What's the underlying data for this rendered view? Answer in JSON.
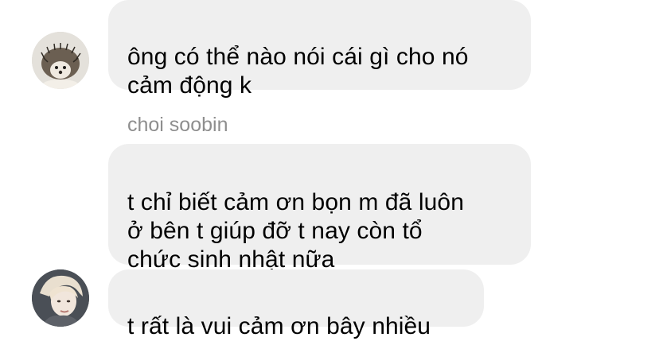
{
  "chat": {
    "messages": [
      {
        "text": "ông có thể nào nói cái gì cho nó\ncảm động k"
      },
      {
        "sender": "choi soobin",
        "text": "t chỉ biết cảm ơn bọn m đã luôn\nở bên t giúp đỡ t nay còn tổ\nchức sinh nhật nữa"
      },
      {
        "text": "t rất là vui cảm ơn bây nhiều"
      }
    ],
    "avatars": [
      {
        "icon": "hedgehog-avatar"
      },
      {
        "icon": "person-avatar"
      }
    ]
  },
  "colors": {
    "bubble": "#efefef",
    "sender_name": "#8e8e8e",
    "text": "#000000",
    "background": "#ffffff"
  }
}
